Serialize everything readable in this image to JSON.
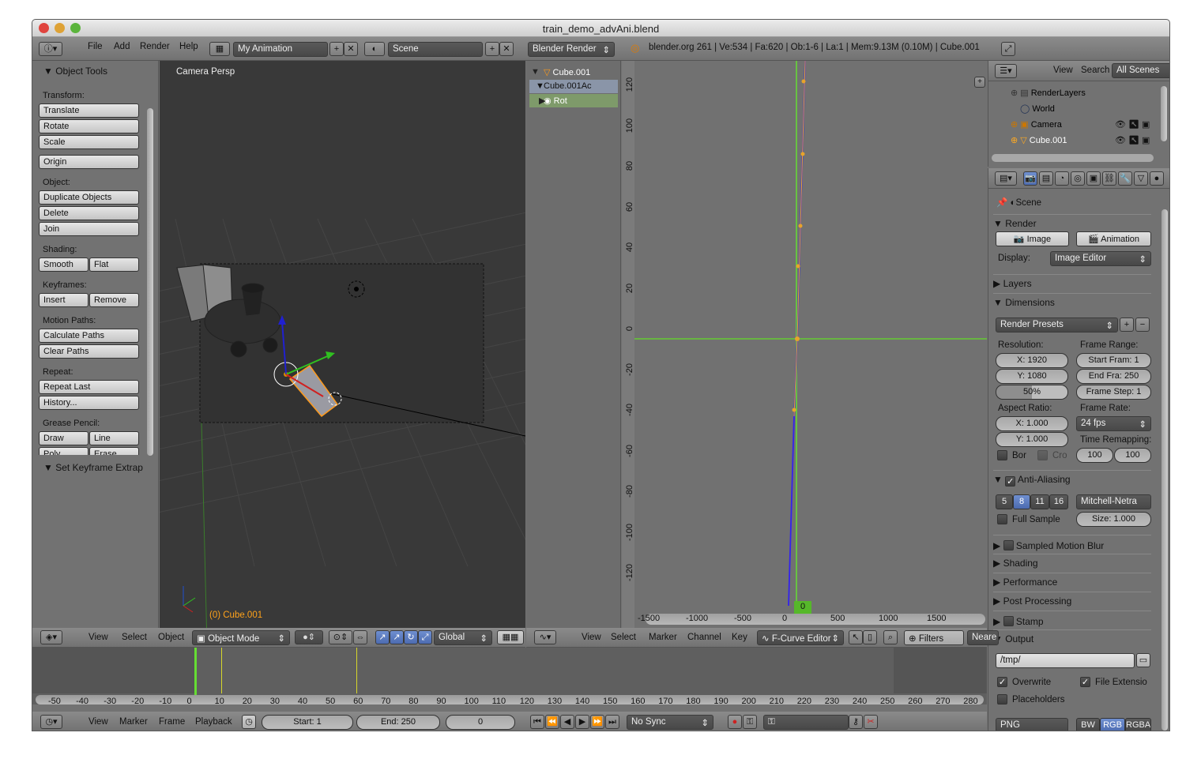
{
  "window": {
    "title": "train_demo_advAni.blend"
  },
  "info_header": {
    "menus": [
      "File",
      "Add",
      "Render",
      "Help"
    ],
    "screen_layout": "My Animation",
    "scene": "Scene",
    "engine": "Blender Render",
    "stats": "blender.org 261 | Ve:534 | Fa:620 | Ob:1-6 | La:1 | Mem:9.13M (0.10M) | Cube.001"
  },
  "tool_shelf": {
    "title": "Object Tools",
    "transform_label": "Transform:",
    "translate": "Translate",
    "rotate": "Rotate",
    "scale": "Scale",
    "origin": "Origin",
    "object_label": "Object:",
    "duplicate": "Duplicate Objects",
    "delete": "Delete",
    "join": "Join",
    "shading_label": "Shading:",
    "smooth": "Smooth",
    "flat": "Flat",
    "keyframes_label": "Keyframes:",
    "insert": "Insert",
    "remove": "Remove",
    "motion_label": "Motion Paths:",
    "calc_paths": "Calculate Paths",
    "clear_paths": "Clear Paths",
    "repeat_label": "Repeat:",
    "repeat_last": "Repeat Last",
    "history": "History...",
    "grease_label": "Grease Pencil:",
    "draw": "Draw",
    "line": "Line",
    "poly": "Poly",
    "erase": "Erase",
    "operator_panel": "Set Keyframe Extrap"
  },
  "viewport": {
    "label": "Camera Persp",
    "active_object": "(0) Cube.001"
  },
  "view3d_header": {
    "menus": [
      "View",
      "Select",
      "Object"
    ],
    "mode": "Object Mode",
    "orientation": "Global"
  },
  "dopesheet": {
    "rows": [
      "Cube.001",
      "Cube.001Ac",
      "Rot"
    ]
  },
  "graph": {
    "y_ticks": [
      "120",
      "100",
      "80",
      "60",
      "40",
      "20",
      "0",
      "-20",
      "-40",
      "-60",
      "-80",
      "-100",
      "-120"
    ],
    "x_ticks": [
      "-1500",
      "-1000",
      "-500",
      "0",
      "500",
      "1000",
      "1500"
    ],
    "current_frame": "0"
  },
  "graph_header": {
    "menus": [
      "View",
      "Select",
      "Marker",
      "Channel",
      "Key"
    ],
    "editor": "F-Curve Editor",
    "filters": "Filters",
    "pivot": "Neare"
  },
  "outliner": {
    "menus": [
      "View",
      "Search"
    ],
    "filter": "All Scenes",
    "items": [
      "RenderLayers",
      "World",
      "Camera",
      "Cube.001"
    ]
  },
  "properties": {
    "context": "Scene",
    "render_panel": "Render",
    "image_btn": "Image",
    "animation_btn": "Animation",
    "display_label": "Display:",
    "display_value": "Image Editor",
    "layers_panel": "Layers",
    "dimensions_panel": "Dimensions",
    "presets": "Render Presets",
    "resolution_label": "Resolution:",
    "res_x": "X: 1920",
    "res_y": "Y: 1080",
    "res_pct": "50%",
    "frame_range_label": "Frame Range:",
    "start_frame": "Start Fram: 1",
    "end_frame": "End Fra: 250",
    "frame_step": "Frame Step: 1",
    "aspect_label": "Aspect Ratio:",
    "aspect_x": "X: 1.000",
    "aspect_y": "Y: 1.000",
    "frame_rate_label": "Frame Rate:",
    "fps": "24 fps",
    "remap_label": "Time Remapping:",
    "remap_old": "100",
    "remap_new": "100",
    "border": "Bor",
    "crop": "Cro",
    "aa_panel": "Anti-Aliasing",
    "aa_samples": [
      "5",
      "8",
      "11",
      "16"
    ],
    "aa_filter": "Mitchell-Netra",
    "full_sample": "Full Sample",
    "aa_size": "Size: 1.000",
    "motion_blur_panel": "Sampled Motion Blur",
    "shading_panel": "Shading",
    "performance_panel": "Performance",
    "post_panel": "Post Processing",
    "stamp_panel": "Stamp",
    "output_panel": "Output",
    "output_path": "/tmp/",
    "overwrite": "Overwrite",
    "file_ext": "File Extensio",
    "placeholders": "Placeholders",
    "format": "PNG",
    "bw": "BW",
    "rgb": "RGB",
    "rgba": "RGBA"
  },
  "timeline": {
    "ticks": [
      "-50",
      "-40",
      "-30",
      "-20",
      "-10",
      "0",
      "10",
      "20",
      "30",
      "40",
      "50",
      "60",
      "70",
      "80",
      "90",
      "100",
      "110",
      "120",
      "130",
      "140",
      "150",
      "160",
      "170",
      "180",
      "190",
      "200",
      "210",
      "220",
      "230",
      "240",
      "250",
      "260",
      "270",
      "280"
    ]
  },
  "timeline_header": {
    "menus": [
      "View",
      "Marker",
      "Frame",
      "Playback"
    ],
    "start": "Start: 1",
    "end": "End: 250",
    "current": "0",
    "sync": "No Sync"
  }
}
